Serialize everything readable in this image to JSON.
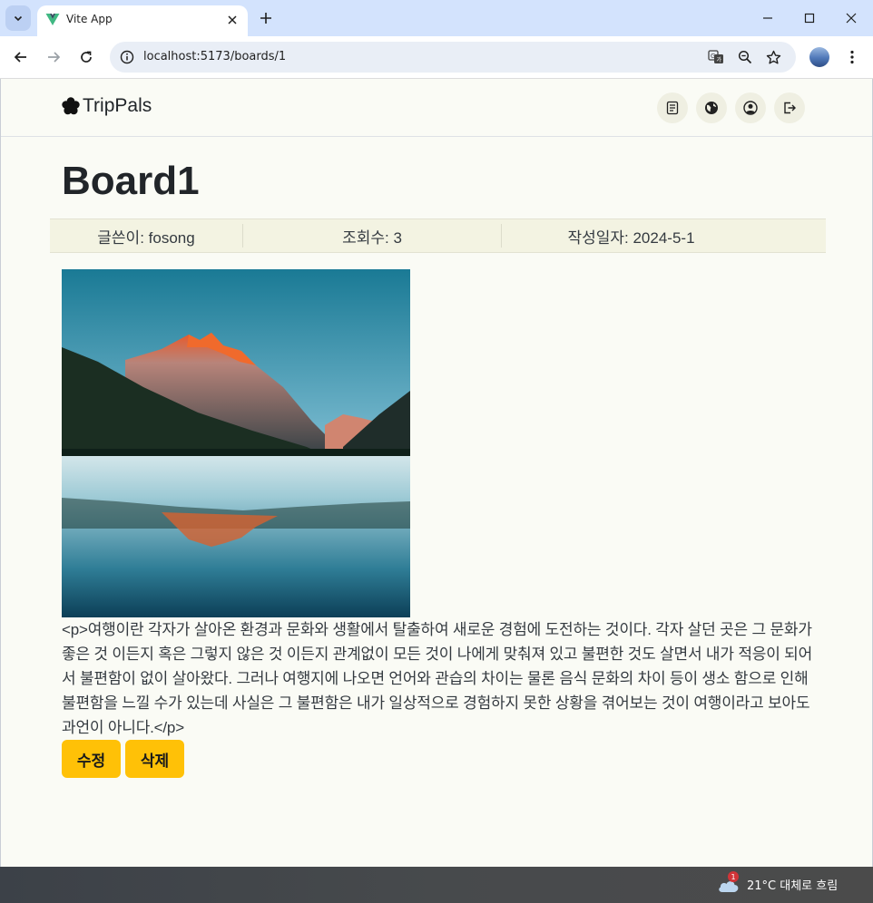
{
  "browser": {
    "tab_title": "Vite App",
    "url": "localhost:5173/boards/1"
  },
  "header": {
    "logo_text": "TripPals",
    "icons": [
      "board-icon",
      "globe-icon",
      "user-icon",
      "logout-icon"
    ]
  },
  "board": {
    "title": "Board1",
    "meta": {
      "writer": "글쓴이: fosong",
      "views": "조회수: 3",
      "date": "작성일자: 2024-5-1"
    },
    "content": "<p>여행이란 각자가 살아온 환경과 문화와 생활에서 탈출하여 새로운 경험에 도전하는 것이다. 각자 살던 곳은 그 문화가 좋은 것 이든지 혹은 그렇지 않은 것 이든지 관계없이 모든 것이 나에게 맞춰져 있고 불편한 것도 살면서 내가 적응이 되어서 불편함이 없이 살아왔다. 그러나 여행지에 나오면 언어와 관습의 차이는 물론 음식 문화의 차이 등이 생소 함으로 인해 불편함을 느낄 수가 있는데 사실은 그 불편함은 내가 일상적으로 경험하지 못한 상황을 겪어보는 것이 여행이라고 보아도 과언이 아니다.</p>",
    "buttons": {
      "edit": "수정",
      "delete": "삭제"
    }
  },
  "colors": {
    "accent": "#ffc107",
    "page_bg": "#fafbf5",
    "meta_bg": "#f3f3e2"
  },
  "taskbar": {
    "weather_badge": "1",
    "weather_text": "21°C  대체로 흐림"
  }
}
